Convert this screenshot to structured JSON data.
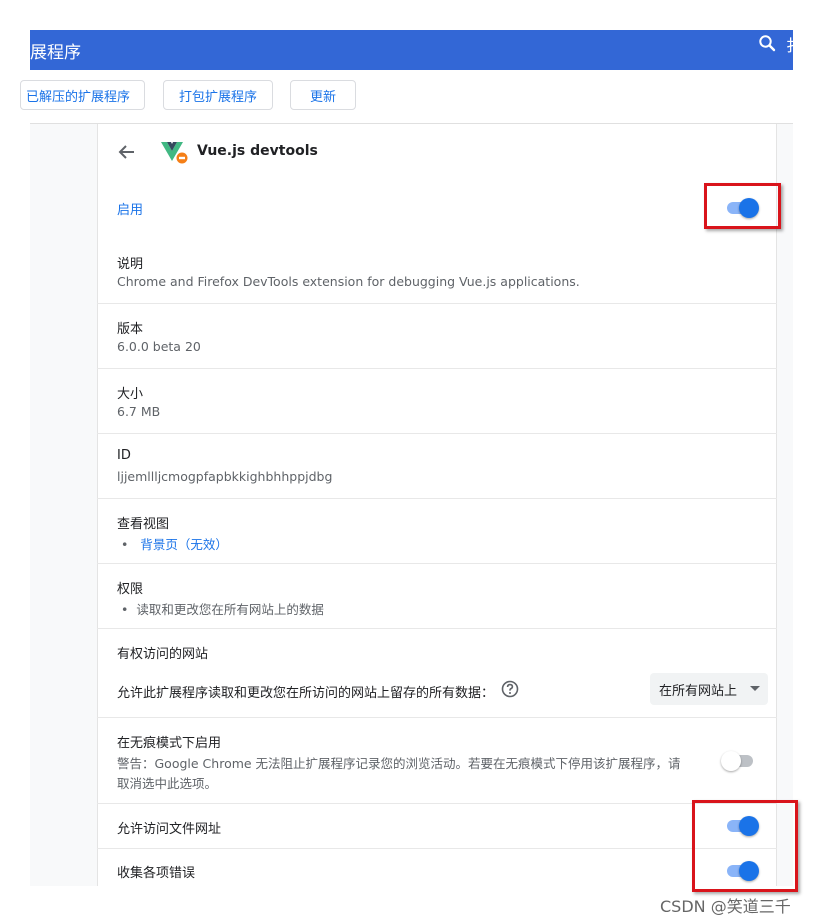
{
  "header": {
    "title": "展程序",
    "cut_char": "扌"
  },
  "toolbar": {
    "load_unpacked": "已解压的扩展程序",
    "pack": "打包扩展程序",
    "update": "更新"
  },
  "extension": {
    "name": "Vue.js devtools",
    "enabled_label": "启用",
    "enabled": true
  },
  "details": {
    "description_label": "说明",
    "description_value": "Chrome and Firefox DevTools extension for debugging Vue.js applications.",
    "version_label": "版本",
    "version_value": "6.0.0 beta 20",
    "size_label": "大小",
    "size_value": "6.7 MB",
    "id_label": "ID",
    "id_value": "ljjemllljcmogpfapbkkighbhhppjdbg",
    "views_label": "查看视图",
    "views_link": "背景页",
    "views_status": "（无效）",
    "permissions_label": "权限",
    "permissions_item": "读取和更改您在所有网站上的数据",
    "site_access_label": "有权访问的网站",
    "site_access_desc": "允许此扩展程序读取和更改您在所访问的网站上留存的所有数据：",
    "site_access_value": "在所有网站上",
    "incognito_label": "在无痕模式下启用",
    "incognito_warning_1": "警告：Google Chrome 无法阻止扩展程序记录您的浏览活动。若要在无痕模式下停用该扩展程序，请",
    "incognito_warning_2": "取消选中此选项。",
    "incognito_enabled": false,
    "file_urls_label": "允许访问文件网址",
    "file_urls_enabled": true,
    "errors_label": "收集各项错误",
    "errors_enabled": true
  },
  "watermark": "CSDN @笑道三千",
  "colors": {
    "header": "#3367d6",
    "accent": "#1a73e8",
    "annotation": "#d9141b"
  }
}
